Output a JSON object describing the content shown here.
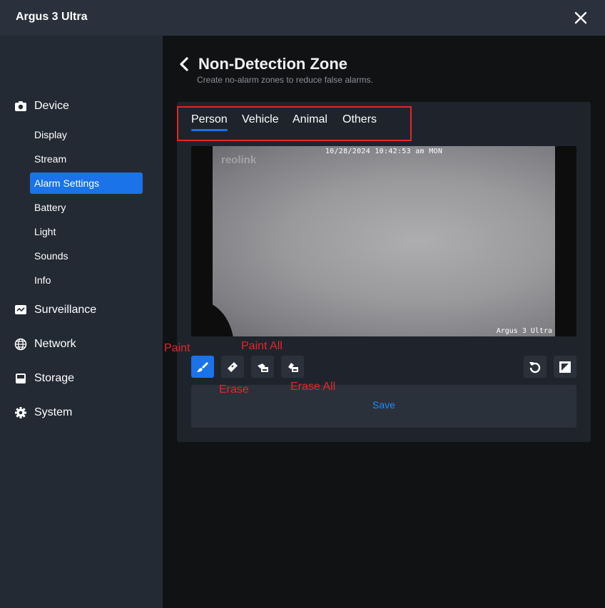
{
  "window": {
    "title": "Argus 3 Ultra",
    "close_icon": "close-icon"
  },
  "sidebar": {
    "sections": [
      {
        "label": "Device",
        "icon": "camera-icon"
      },
      {
        "label": "Surveillance",
        "icon": "monitor-icon"
      },
      {
        "label": "Network",
        "icon": "globe-icon"
      },
      {
        "label": "Storage",
        "icon": "storage-icon"
      },
      {
        "label": "System",
        "icon": "gear-icon"
      }
    ],
    "device_items": [
      "Display",
      "Stream",
      "Alarm Settings",
      "Battery",
      "Light",
      "Sounds",
      "Info"
    ],
    "active_item": "Alarm Settings"
  },
  "header": {
    "title": "Non-Detection Zone",
    "subtitle": "Create no-alarm zones to reduce false alarms."
  },
  "tabs": [
    "Person",
    "Vehicle",
    "Animal",
    "Others"
  ],
  "active_tab": "Person",
  "preview": {
    "timestamp": "10/28/2024 10:42:53 am MON",
    "logo": "reolink",
    "camera_name": "Argus 3 Ultra"
  },
  "tools": {
    "paint": "paint-icon",
    "erase": "erase-icon",
    "paint_all": "paint-all-icon",
    "erase_all": "erase-all-icon",
    "undo": "undo-icon",
    "invert": "invert-icon"
  },
  "save_label": "Save",
  "annotations": {
    "paint": "Paint",
    "paint_all": "Paint All",
    "erase": "Erase",
    "erase_all": "Erase All"
  },
  "colors": {
    "accent": "#1a73e8",
    "annotation": "#e5252a",
    "save_text": "#1a8cff"
  }
}
